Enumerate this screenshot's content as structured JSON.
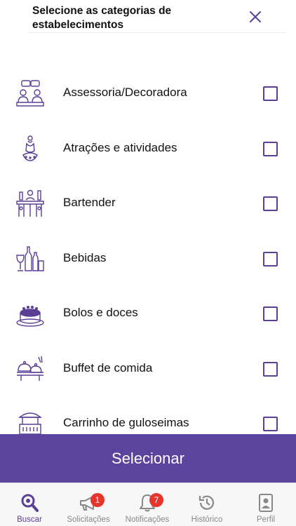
{
  "header": {
    "title": "Selecione as categorias de estabelecimentos",
    "close_icon": "close-icon"
  },
  "categories": [
    {
      "label": "Assessoria/Decoradora",
      "icon": "advisory-meeting-icon",
      "checked": false
    },
    {
      "label": "Atrações e atividades",
      "icon": "attractions-figure-icon",
      "checked": false
    },
    {
      "label": "Bartender",
      "icon": "bartender-bar-icon",
      "checked": false
    },
    {
      "label": "Bebidas",
      "icon": "drinks-bottles-icon",
      "checked": false
    },
    {
      "label": "Bolos e doces",
      "icon": "cake-icon",
      "checked": false
    },
    {
      "label": "Buffet de comida",
      "icon": "buffet-food-icon",
      "checked": false
    },
    {
      "label": "Carrinho de guloseimas",
      "icon": "candy-cart-icon",
      "checked": false
    }
  ],
  "select_button": {
    "label": "Selecionar"
  },
  "tabbar": {
    "tabs": [
      {
        "label": "Buscar",
        "icon": "search-icon",
        "active": true
      },
      {
        "label": "Solicitações",
        "icon": "megaphone-icon",
        "badge": "1"
      },
      {
        "label": "Notificações",
        "icon": "bell-icon",
        "badge": "7"
      },
      {
        "label": "Histórico",
        "icon": "history-icon"
      },
      {
        "label": "Perfil",
        "icon": "profile-card-icon"
      }
    ]
  },
  "colors": {
    "accent": "#5b449d",
    "icon_stroke": "#5b3f95",
    "badge": "#e5352d"
  }
}
